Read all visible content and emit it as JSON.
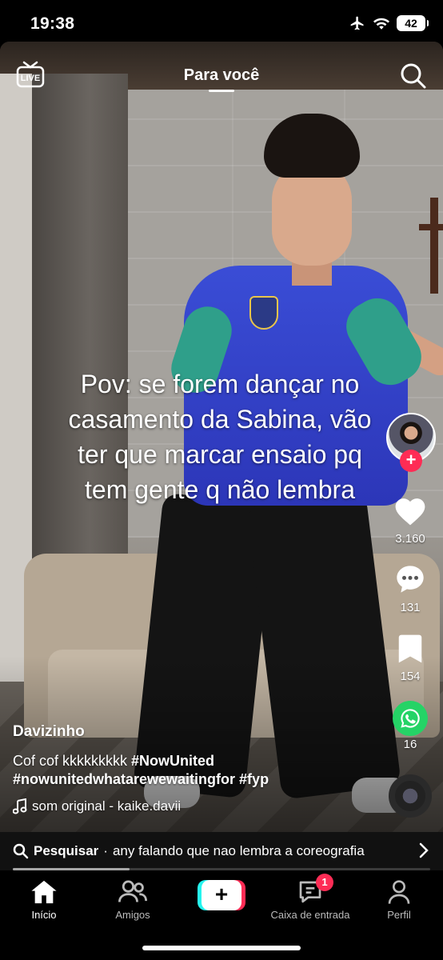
{
  "status_bar": {
    "time": "19:38",
    "battery": "42"
  },
  "top_nav": {
    "live_label": "LIVE",
    "title": "Para você"
  },
  "video": {
    "caption": "Pov: se forem dançar no\ncasamento da Sabina, vão\nter que marcar ensaio pq\ntem gente q não lembra"
  },
  "actions": {
    "likes": "3.160",
    "comments": "131",
    "saves": "154",
    "shares": "16"
  },
  "post": {
    "username": "Davizinho",
    "description_text": "Cof cof kkkkkkkkk",
    "hashtag_1": "#NowUnited",
    "hashtag_2": "#nowunitedwhatarewewaitingfor",
    "hashtag_3": "#fyp",
    "sound": "som original - kaike.davii"
  },
  "search_strip": {
    "label": "Pesquisar",
    "separator": "·",
    "query": "any falando que nao lembra a coreografia",
    "progress_fraction": 0.28
  },
  "tabs": [
    {
      "label": "Início",
      "icon": "home-icon",
      "active": true
    },
    {
      "label": "Amigos",
      "icon": "friends-icon",
      "active": false
    },
    {
      "label": "Caixa de entrada",
      "icon": "inbox-icon",
      "active": false,
      "badge": "1"
    },
    {
      "label": "Perfil",
      "icon": "profile-icon",
      "active": false
    }
  ],
  "colors": {
    "accent": "#fe2c55",
    "create_cyan": "#25f4ee",
    "whatsapp": "#25d366"
  }
}
